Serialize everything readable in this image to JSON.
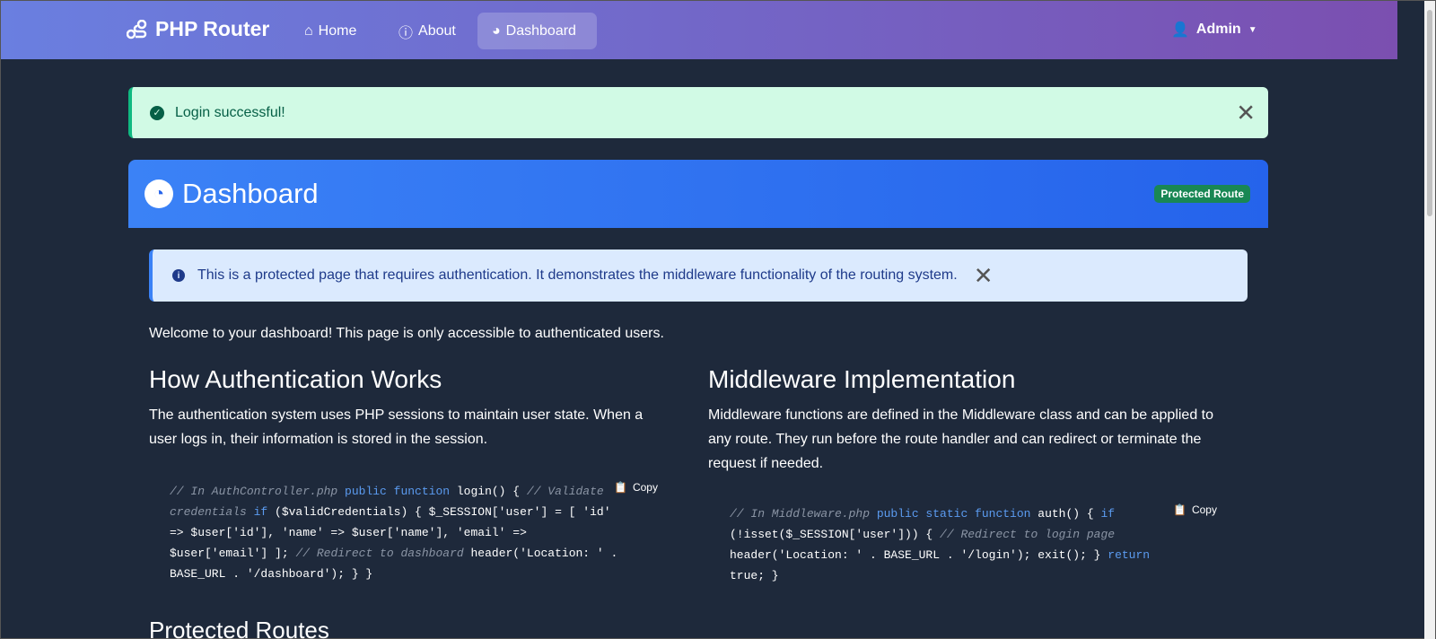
{
  "nav": {
    "brand": "PHP Router",
    "links": [
      {
        "label": "Home"
      },
      {
        "label": "About"
      },
      {
        "label": "Dashboard",
        "active": true
      }
    ],
    "user": "Admin"
  },
  "alert_success": {
    "text": "Login successful!"
  },
  "card": {
    "title": "Dashboard",
    "badge": "Protected Route"
  },
  "alert_info": {
    "text": "This is a protected page that requires authentication. It demonstrates the middleware functionality of the routing system."
  },
  "welcome": "Welcome to your dashboard! This page is only accessible to authenticated users.",
  "left": {
    "heading": "How Authentication Works",
    "text": "The authentication system uses PHP sessions to maintain user state. When a user logs in, their information is stored in the session.",
    "copy": "Copy",
    "code": [
      [
        [
          "cm",
          "// In AuthController.php "
        ],
        [
          "kw",
          "public function "
        ],
        [
          "",
          "login() { "
        ],
        [
          "cm",
          "// Validate"
        ]
      ],
      [
        [
          "cm",
          "credentials "
        ],
        [
          "kw",
          "if "
        ],
        [
          "",
          "($validCredentials) { $_SESSION['user'] = [ 'id'"
        ]
      ],
      [
        [
          "",
          "=> $user['id'], 'name' => $user['name'], 'email' =>"
        ]
      ],
      [
        [
          "",
          "$user['email'] ]; "
        ],
        [
          "cm",
          "// Redirect to dashboard "
        ],
        [
          "",
          "header('Location: ' ."
        ]
      ],
      [
        [
          "",
          "BASE_URL . '/dashboard'); } }"
        ]
      ]
    ]
  },
  "right": {
    "heading": "Middleware Implementation",
    "text": "Middleware functions are defined in the Middleware class and can be applied to any route. They run before the route handler and can redirect or terminate the request if needed.",
    "copy": "Copy",
    "code": [
      [
        [
          "cm",
          "// In Middleware.php "
        ],
        [
          "kw",
          "public static function "
        ],
        [
          "",
          "auth() { "
        ],
        [
          "kw",
          "if"
        ]
      ],
      [
        [
          "",
          "(!isset($_SESSION['user'])) { "
        ],
        [
          "cm",
          "// Redirect to login page"
        ]
      ],
      [
        [
          "",
          "header('Location: ' . BASE_URL . '/login'); exit(); } "
        ],
        [
          "kw",
          "return"
        ]
      ],
      [
        [
          "",
          "true; }"
        ]
      ]
    ]
  },
  "next_heading": "Protected Routes"
}
